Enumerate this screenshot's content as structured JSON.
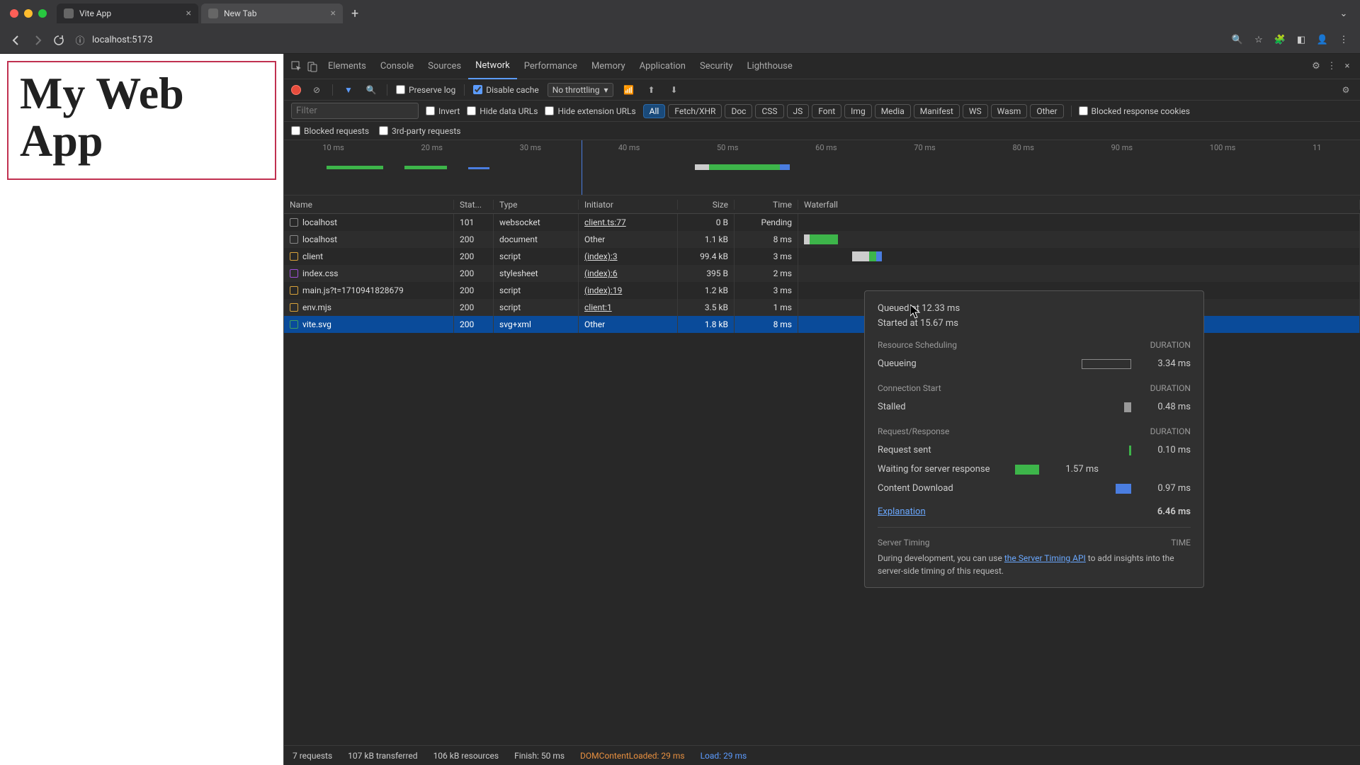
{
  "browser": {
    "tabs": [
      {
        "title": "Vite App",
        "active": true
      },
      {
        "title": "New Tab",
        "active": false
      }
    ],
    "url": "localhost:5173"
  },
  "page": {
    "heading": "My Web App"
  },
  "devtools": {
    "tabs": [
      "Elements",
      "Console",
      "Sources",
      "Network",
      "Performance",
      "Memory",
      "Application",
      "Security",
      "Lighthouse"
    ],
    "active_tab": "Network",
    "preserve_log": "Preserve log",
    "disable_cache": "Disable cache",
    "throttling": "No throttling",
    "filter_placeholder": "Filter",
    "invert": "Invert",
    "hide_data_urls": "Hide data URLs",
    "hide_ext_urls": "Hide extension URLs",
    "blocked_cookies": "Blocked response cookies",
    "type_filters": [
      "All",
      "Fetch/XHR",
      "Doc",
      "CSS",
      "JS",
      "Font",
      "Img",
      "Media",
      "Manifest",
      "WS",
      "Wasm",
      "Other"
    ],
    "blocked_requests": "Blocked requests",
    "third_party": "3rd-party requests",
    "timeline_ticks": [
      "10 ms",
      "20 ms",
      "30 ms",
      "40 ms",
      "50 ms",
      "60 ms",
      "70 ms",
      "80 ms",
      "90 ms",
      "100 ms",
      "11"
    ],
    "columns": {
      "name": "Name",
      "status": "Stat...",
      "type": "Type",
      "initiator": "Initiator",
      "size": "Size",
      "time": "Time",
      "waterfall": "Waterfall"
    },
    "rows": [
      {
        "name": "localhost",
        "status": "101",
        "type": "websocket",
        "initiator": "client.ts:77",
        "initiator_link": true,
        "size": "0 B",
        "time": "Pending",
        "ico": "",
        "wf": []
      },
      {
        "name": "localhost",
        "status": "200",
        "type": "document",
        "initiator": "Other",
        "initiator_link": false,
        "size": "1.1 kB",
        "time": "8 ms",
        "ico": "",
        "wf": [
          {
            "l": 0,
            "w": 8,
            "c": "#ccc"
          },
          {
            "l": 8,
            "w": 40,
            "c": "#3db54a"
          }
        ]
      },
      {
        "name": "client",
        "status": "200",
        "type": "script",
        "initiator": "(index):3",
        "initiator_link": true,
        "size": "99.4 kB",
        "time": "3 ms",
        "ico": "fi-js",
        "wf": [
          {
            "l": 68,
            "w": 24,
            "c": "#ccc"
          },
          {
            "l": 92,
            "w": 10,
            "c": "#3db54a"
          },
          {
            "l": 102,
            "w": 8,
            "c": "#4a7de0"
          }
        ]
      },
      {
        "name": "index.css",
        "status": "200",
        "type": "stylesheet",
        "initiator": "(index):6",
        "initiator_link": true,
        "size": "395 B",
        "time": "2 ms",
        "ico": "fi-css",
        "wf": []
      },
      {
        "name": "main.js?t=1710941828679",
        "status": "200",
        "type": "script",
        "initiator": "(index):19",
        "initiator_link": true,
        "size": "1.2 kB",
        "time": "3 ms",
        "ico": "fi-js",
        "wf": []
      },
      {
        "name": "env.mjs",
        "status": "200",
        "type": "script",
        "initiator": "client:1",
        "initiator_link": true,
        "size": "3.5 kB",
        "time": "1 ms",
        "ico": "fi-js",
        "wf": []
      },
      {
        "name": "vite.svg",
        "status": "200",
        "type": "svg+xml",
        "initiator": "Other",
        "initiator_link": false,
        "size": "1.8 kB",
        "time": "8 ms",
        "ico": "fi-svg",
        "wf": []
      }
    ],
    "selected_row": 6
  },
  "tooltip": {
    "queued": "Queued at 12.33 ms",
    "started": "Started at 15.67 ms",
    "sections": {
      "resource_scheduling": "Resource Scheduling",
      "connection_start": "Connection Start",
      "request_response": "Request/Response",
      "server_timing": "Server Timing"
    },
    "duration_label": "DURATION",
    "time_label": "TIME",
    "queueing_label": "Queueing",
    "queueing_value": "3.34 ms",
    "stalled_label": "Stalled",
    "stalled_value": "0.48 ms",
    "request_sent_label": "Request sent",
    "request_sent_value": "0.10 ms",
    "waiting_label": "Waiting for server response",
    "waiting_value": "1.57 ms",
    "download_label": "Content Download",
    "download_value": "0.97 ms",
    "explanation_label": "Explanation",
    "total_value": "6.46 ms",
    "server_timing_note_pre": "During development, you can use ",
    "server_timing_link": "the Server Timing API",
    "server_timing_note_post": " to add insights into the server-side timing of this request."
  },
  "statusbar": {
    "requests": "7 requests",
    "transferred": "107 kB transferred",
    "resources": "106 kB resources",
    "finish": "Finish: 50 ms",
    "domloaded": "DOMContentLoaded: 29 ms",
    "load": "Load: 29 ms"
  }
}
